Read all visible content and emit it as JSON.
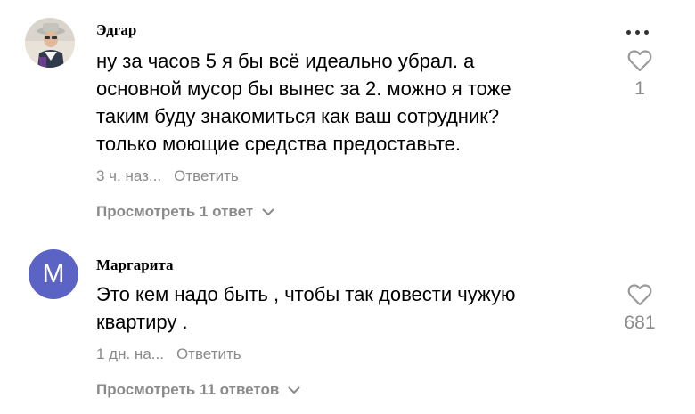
{
  "comments": [
    {
      "author": "Эдгар",
      "text_lines": [
        "ну за часов 5 я бы всё идеально убрал. а",
        "основной мусор бы вынес за 2. можно я тоже",
        "таким буду знакомиться как ваш сотрудник?",
        "только моющие средства предоставьте."
      ],
      "time": "3 ч. наз...",
      "reply_label": "Ответить",
      "view_replies": "Просмотреть 1 ответ",
      "likes": "1",
      "avatar_type": "photo"
    },
    {
      "author": "Маргарита",
      "avatar_letter": "М",
      "text_lines": [
        "Это кем надо быть , чтобы так довести чужую",
        "квартиру ."
      ],
      "time": "1 дн. на...",
      "reply_label": "Ответить",
      "view_replies": "Просмотреть 11 ответов",
      "likes": "681",
      "avatar_type": "letter"
    }
  ],
  "icons": {
    "more": "more-dots-icon",
    "like": "heart-outline-icon",
    "expand": "chevron-down-icon"
  },
  "colors": {
    "avatar_letter_bg": "#5b63c4",
    "secondary_text": "#8a8a8a",
    "icon_gray": "#9a9a9a"
  }
}
